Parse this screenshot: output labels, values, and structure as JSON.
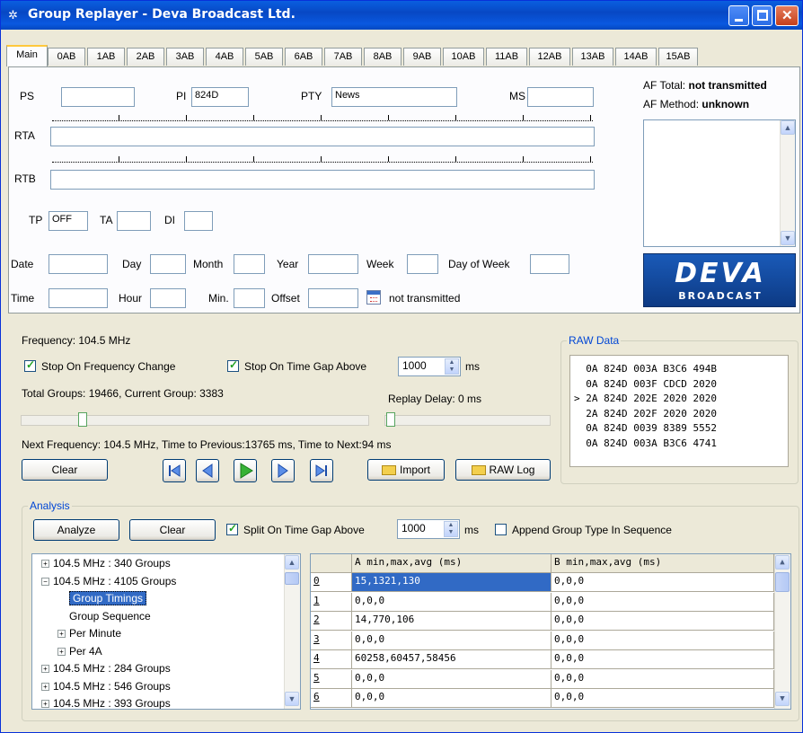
{
  "window": {
    "title": "Group Replayer - Deva Broadcast Ltd."
  },
  "tabs": [
    "Main",
    "0AB",
    "1AB",
    "2AB",
    "3AB",
    "4AB",
    "5AB",
    "6AB",
    "7AB",
    "8AB",
    "9AB",
    "10AB",
    "11AB",
    "12AB",
    "13AB",
    "14AB",
    "15AB"
  ],
  "main": {
    "ps_label": "PS",
    "ps_value": "",
    "pi_label": "PI",
    "pi_value": "824D",
    "pty_label": "PTY",
    "pty_value": "News",
    "ms_label": "MS",
    "ms_value": "",
    "rta_label": "RTA",
    "rtb_label": "RTB",
    "tp_label": "TP",
    "tp_value": "OFF",
    "ta_label": "TA",
    "di_label": "DI",
    "date_label": "Date",
    "day_label": "Day",
    "month_label": "Month",
    "year_label": "Year",
    "week_label": "Week",
    "dow_label": "Day of Week",
    "time_label": "Time",
    "hour_label": "Hour",
    "min_label": "Min.",
    "offset_label": "Offset",
    "time_status": "not transmitted",
    "af_total_label": "AF Total:",
    "af_total_value": "not transmitted",
    "af_method_label": "AF Method:",
    "af_method_value": "unknown",
    "logo_main": "DEVA",
    "logo_sub": "BROADCAST"
  },
  "replay": {
    "frequency": "Frequency: 104.5 MHz",
    "stop_freq_change": "Stop On Frequency Change",
    "stop_time_gap": "Stop On Time Gap Above",
    "gap_value": "1000",
    "gap_unit": "ms",
    "total_groups": "Total Groups: 19466, Current Group: 3383",
    "replay_delay": "Replay Delay: 0 ms",
    "next_frequency": "Next Frequency: 104.5 MHz, Time to Previous:13765 ms, Time to Next:94 ms",
    "clear": "Clear",
    "import": "Import",
    "raw_log": "RAW Log",
    "position_fraction": 0.17,
    "delay_fraction": 0.0
  },
  "raw_data": {
    "legend": "RAW Data",
    "lines": [
      "  0A 824D 003A B3C6 494B",
      "  0A 824D 003F CDCD 2020",
      "> 2A 824D 202E 2020 2020",
      "  2A 824D 202F 2020 2020",
      "  0A 824D 0039 8389 5552",
      "  0A 824D 003A B3C6 4741"
    ]
  },
  "analysis": {
    "legend": "Analysis",
    "analyze": "Analyze",
    "clear": "Clear",
    "split_label": "Split On Time Gap Above",
    "split_value": "1000",
    "unit": "ms",
    "append_label": "Append Group Type In Sequence",
    "tree": [
      {
        "label": "104.5 MHz : 340 Groups",
        "exp": "+"
      },
      {
        "label": "104.5 MHz : 4105 Groups",
        "exp": "−"
      },
      {
        "label": "Group Timings",
        "exp": ""
      },
      {
        "label": "Group Sequence",
        "exp": ""
      },
      {
        "label": "Per Minute",
        "exp": "+"
      },
      {
        "label": "Per 4A",
        "exp": "+"
      },
      {
        "label": "104.5 MHz : 284 Groups",
        "exp": "+"
      },
      {
        "label": "104.5 MHz : 546 Groups",
        "exp": "+"
      },
      {
        "label": "104.5 MHz : 393 Groups",
        "exp": "+"
      }
    ],
    "table_headers": [
      "A min,max,avg (ms)",
      "B min,max,avg (ms)"
    ],
    "rows": [
      {
        "id": "0",
        "a": "15,1321,130",
        "b": "0,0,0"
      },
      {
        "id": "1",
        "a": "0,0,0",
        "b": "0,0,0"
      },
      {
        "id": "2",
        "a": "14,770,106",
        "b": "0,0,0"
      },
      {
        "id": "3",
        "a": "0,0,0",
        "b": "0,0,0"
      },
      {
        "id": "4",
        "a": "60258,60457,58456",
        "b": "0,0,0"
      },
      {
        "id": "5",
        "a": "0,0,0",
        "b": "0,0,0"
      },
      {
        "id": "6",
        "a": "0,0,0",
        "b": "0,0,0"
      }
    ]
  }
}
